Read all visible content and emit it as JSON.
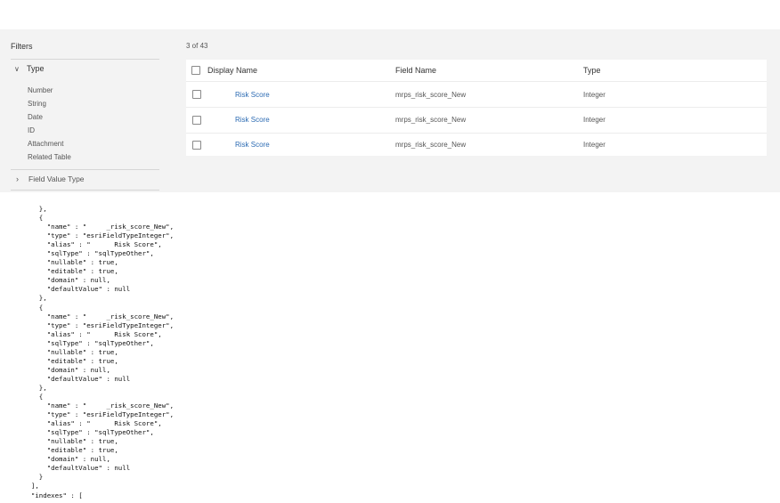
{
  "filters": {
    "title": "Filters",
    "type_group": {
      "label": "Type",
      "options": [
        "Number",
        "String",
        "Date",
        "ID",
        "Attachment",
        "Related Table"
      ]
    },
    "field_value_type_group": {
      "label": "Field Value Type"
    }
  },
  "table": {
    "count": "3 of 43",
    "columns": [
      "Display Name",
      "Field Name",
      "Type"
    ],
    "rows": [
      {
        "display_name": "Risk Score",
        "field_name": "mrps_risk_score_New",
        "type": "Integer"
      },
      {
        "display_name": "Risk Score",
        "field_name": "mrps_risk_score_New",
        "type": "Integer"
      },
      {
        "display_name": "Risk Score",
        "field_name": "mrps_risk_score_New",
        "type": "Integer"
      }
    ]
  },
  "code": {
    "lines": [
      "    },",
      "    {",
      "      \"name\" : \"     _risk_score_New\",",
      "      \"type\" : \"esriFieldTypeInteger\",",
      "      \"alias\" : \"      Risk Score\",",
      "      \"sqlType\" : \"sqlTypeOther\",",
      "      \"nullable\" : true,",
      "      \"editable\" : true,",
      "      \"domain\" : null,",
      "      \"defaultValue\" : null",
      "    },",
      "    {",
      "      \"name\" : \"     _risk_score_New\",",
      "      \"type\" : \"esriFieldTypeInteger\",",
      "      \"alias\" : \"      Risk Score\",",
      "      \"sqlType\" : \"sqlTypeOther\",",
      "      \"nullable\" : true,",
      "      \"editable\" : true,",
      "      \"domain\" : null,",
      "      \"defaultValue\" : null",
      "    },",
      "    {",
      "      \"name\" : \"     _risk_score_New\",",
      "      \"type\" : \"esriFieldTypeInteger\",",
      "      \"alias\" : \"      Risk Score\",",
      "      \"sqlType\" : \"sqlTypeOther\",",
      "      \"nullable\" : true,",
      "      \"editable\" : true,",
      "      \"domain\" : null,",
      "      \"defaultValue\" : null",
      "    }",
      "  ],",
      "  \"indexes\" : ["
    ]
  },
  "icons": {
    "expanded": "chevron-down-icon",
    "collapsed": "chevron-right-icon"
  }
}
